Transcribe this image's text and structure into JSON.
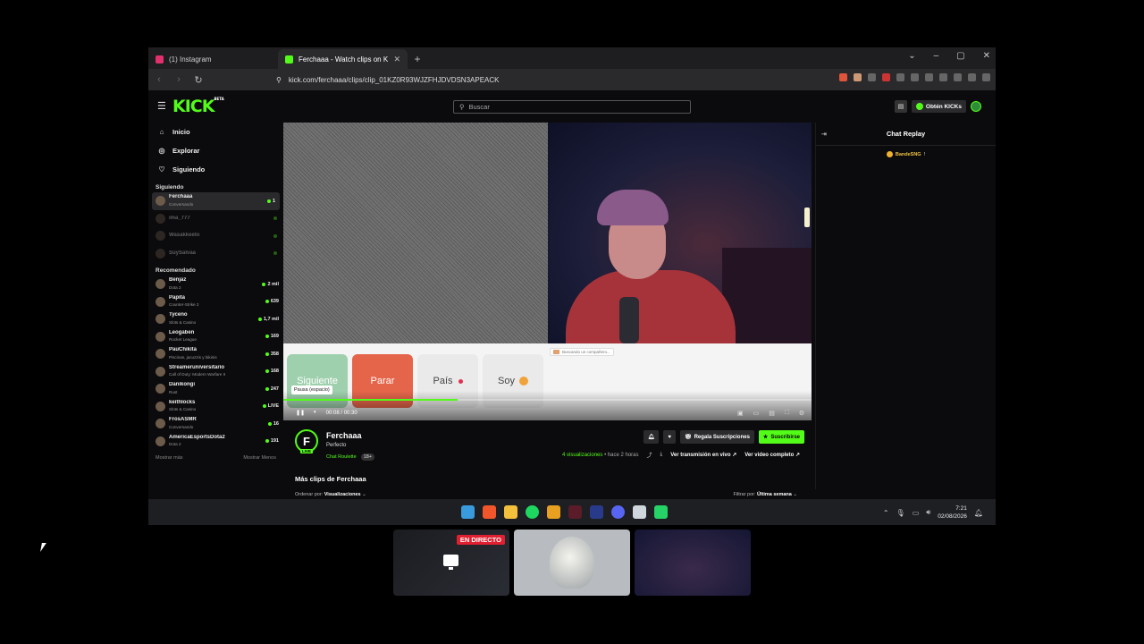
{
  "browser": {
    "tabs": [
      {
        "title": "(1) Instagram",
        "favicon_color": "#e1306c"
      },
      {
        "title": "Ferchaaa - Watch clips on Kic",
        "favicon_color": "#53fc18"
      }
    ],
    "url": "kick.com/ferchaaa/clips/clip_01KZ0R93WJZFHJDVDSN3APEACK"
  },
  "header": {
    "logo": "KICK",
    "logo_badge": "BETA",
    "search_placeholder": "Buscar",
    "kicks_label": "Obtén KICKs"
  },
  "sidebar": {
    "nav": [
      {
        "label": "Inicio",
        "icon": "home-icon"
      },
      {
        "label": "Explorar",
        "icon": "compass-icon"
      },
      {
        "label": "Siguiendo",
        "icon": "heart-icon"
      }
    ],
    "following_title": "Siguiendo",
    "following": [
      {
        "name": "Ferchaaa",
        "sub": "Conversando",
        "viewers": "1",
        "live": true
      },
      {
        "name": "ima_777",
        "sub": "",
        "viewers": "",
        "live": false
      },
      {
        "name": "Wasakkeeto",
        "sub": "",
        "viewers": "",
        "live": false
      },
      {
        "name": "SuySalvaa",
        "sub": "",
        "viewers": "",
        "live": false
      }
    ],
    "recommended_title": "Recomendado",
    "recommended": [
      {
        "name": "Benjaz",
        "sub": "Dota 2",
        "viewers": "2 mil"
      },
      {
        "name": "Papita",
        "sub": "Counter-Strike 2",
        "viewers": "639"
      },
      {
        "name": "Tyceno",
        "sub": "Slots & Casino",
        "viewers": "1,7 mil"
      },
      {
        "name": "Leogaben",
        "sub": "Rocket League",
        "viewers": "169"
      },
      {
        "name": "PauChikita",
        "sub": "Piscinas, jacuzzis y bikinis",
        "viewers": "358"
      },
      {
        "name": "Streameruniversitario",
        "sub": "Call of Duty: Modern Warfare II",
        "viewers": "168"
      },
      {
        "name": "Danikongi",
        "sub": "Rust",
        "viewers": "247"
      },
      {
        "name": "keithlocks",
        "sub": "Slots & Casino",
        "viewers": "LIVE"
      },
      {
        "name": "FrosASMR",
        "sub": "Conversando",
        "viewers": "16"
      },
      {
        "name": "AmericaEsportsDota2",
        "sub": "Dota 2",
        "viewers": "191"
      }
    ],
    "show_more": "Mostrar más",
    "show_less": "Mostrar Menos"
  },
  "player": {
    "roulette_buttons": [
      "Siguiente",
      "Parar",
      "País",
      "Soy"
    ],
    "searching_text": "Buscando un compañero...",
    "tooltip": "Pausa (espacio)",
    "time": "00:08 / 00:30",
    "progress": 0.33
  },
  "channel": {
    "initial": "F",
    "live_tag": "LIVE",
    "name": "Ferchaaa",
    "title": "Perfecto",
    "category": "Chat Roulette",
    "age": "18+",
    "gift_label": "Regala Suscripciones",
    "subscribe_label": "Suscribirse",
    "views": "4 visualizaciones",
    "ago": "• hace 2 horas",
    "watch_live": "Ver transmisión en vivo",
    "full_video": "Ver video completo",
    "clips_heading": "Más clips de Ferchaaa",
    "order_label": "Ordenar por:",
    "order_value": "Visualizaciones",
    "filter_label": "Filtrar por:",
    "filter_value": "Última semana"
  },
  "chat": {
    "title": "Chat Replay",
    "messages": [
      {
        "user": "BandeSNG",
        "text": "!"
      }
    ]
  },
  "taskbar": {
    "time": "7:21",
    "date": "02/08/2026"
  },
  "overlay": {
    "live_badge": "EN DIRECTO"
  }
}
